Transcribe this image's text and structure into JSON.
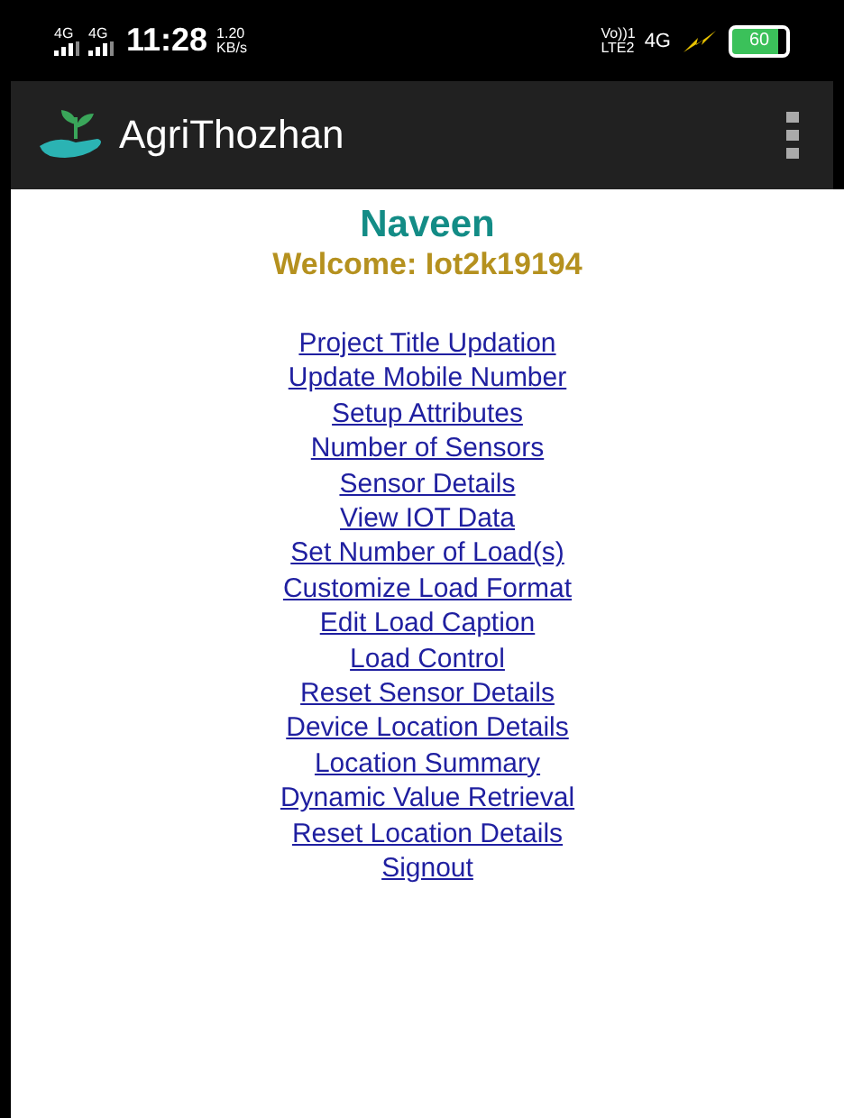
{
  "status_bar": {
    "sim_labels": [
      "4G",
      "4G"
    ],
    "time": "11:28",
    "speed": "1.20",
    "speed_unit": "KB/s",
    "volte_top": "Vo))1",
    "volte_bottom": "LTE2",
    "network": "4G",
    "battery": "60"
  },
  "app_bar": {
    "title": "AgriThozhan"
  },
  "user": {
    "name": "Naveen",
    "welcome": "Welcome: Iot2k19194"
  },
  "links": [
    "Project Title Updation",
    "Update Mobile Number",
    "Setup Attributes",
    "Number of Sensors",
    "Sensor Details",
    "View IOT Data",
    "Set Number of Load(s)",
    "Customize Load Format",
    "Edit Load Caption",
    "Load Control",
    "Reset Sensor Details",
    "Device Location Details",
    "Location Summary",
    "Dynamic Value Retrieval",
    "Reset Location Details",
    "Signout"
  ]
}
